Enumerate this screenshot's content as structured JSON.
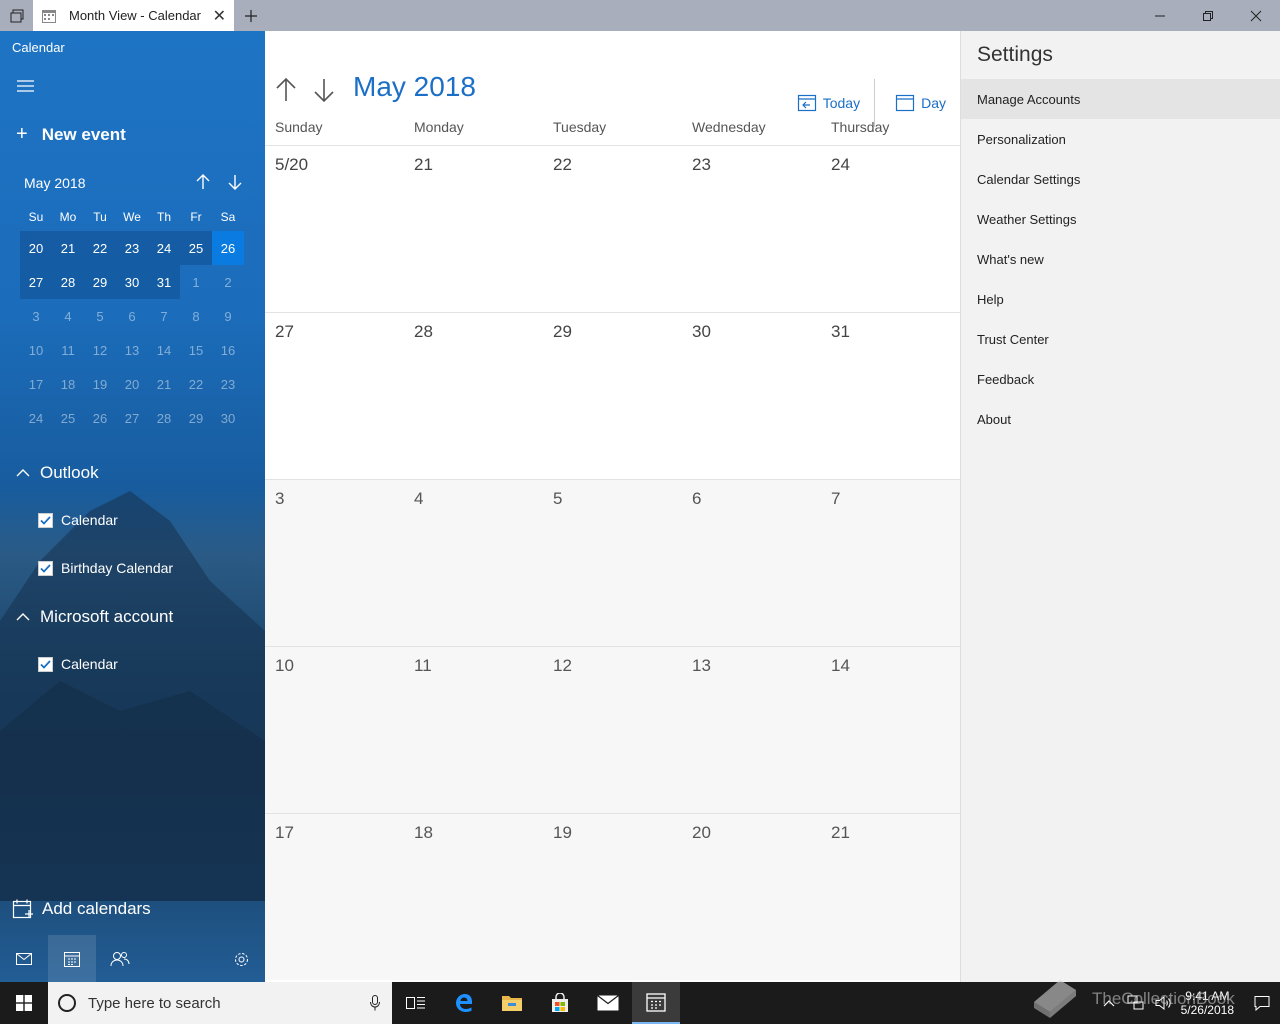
{
  "window": {
    "tab_title": "Month View - Calendar",
    "colors": {
      "accent": "#1b6fc6",
      "sidebar": "#1e74c4",
      "today": "#0a7be0",
      "titlebar": "#a8aebb"
    }
  },
  "sidebar": {
    "app_title": "Calendar",
    "new_event": "New event",
    "mini": {
      "title": "May 2018",
      "dow": [
        "Su",
        "Mo",
        "Tu",
        "We",
        "Th",
        "Fr",
        "Sa"
      ],
      "weeks": [
        [
          "20",
          "21",
          "22",
          "23",
          "24",
          "25",
          "26"
        ],
        [
          "27",
          "28",
          "29",
          "30",
          "31",
          "1",
          "2"
        ],
        [
          "3",
          "4",
          "5",
          "6",
          "7",
          "8",
          "9"
        ],
        [
          "10",
          "11",
          "12",
          "13",
          "14",
          "15",
          "16"
        ],
        [
          "17",
          "18",
          "19",
          "20",
          "21",
          "22",
          "23"
        ],
        [
          "24",
          "25",
          "26",
          "27",
          "28",
          "29",
          "30"
        ]
      ]
    },
    "groups": [
      {
        "name": "Outlook",
        "calendars": [
          "Calendar",
          "Birthday Calendar"
        ]
      },
      {
        "name": "Microsoft account",
        "calendars": [
          "Calendar"
        ]
      }
    ],
    "add_calendars": "Add calendars"
  },
  "main": {
    "month_title": "May 2018",
    "today_label": "Today",
    "day_label": "Day",
    "dow": [
      "Sunday",
      "Monday",
      "Tuesday",
      "Wednesday",
      "Thursday"
    ],
    "weeks": [
      [
        "5/20",
        "21",
        "22",
        "23",
        "24"
      ],
      [
        "27",
        "28",
        "29",
        "30",
        "31"
      ],
      [
        "3",
        "4",
        "5",
        "6",
        "7"
      ],
      [
        "10",
        "11",
        "12",
        "13",
        "14"
      ],
      [
        "17",
        "18",
        "19",
        "20",
        "21"
      ]
    ]
  },
  "settings": {
    "title": "Settings",
    "items": [
      "Manage Accounts",
      "Personalization",
      "Calendar Settings",
      "Weather Settings",
      "What's new",
      "Help",
      "Trust Center",
      "Feedback",
      "About"
    ]
  },
  "taskbar": {
    "search_placeholder": "Type here to search",
    "time": "9:41 AM",
    "date": "5/26/2018"
  },
  "watermark": "TheCollectionBook"
}
